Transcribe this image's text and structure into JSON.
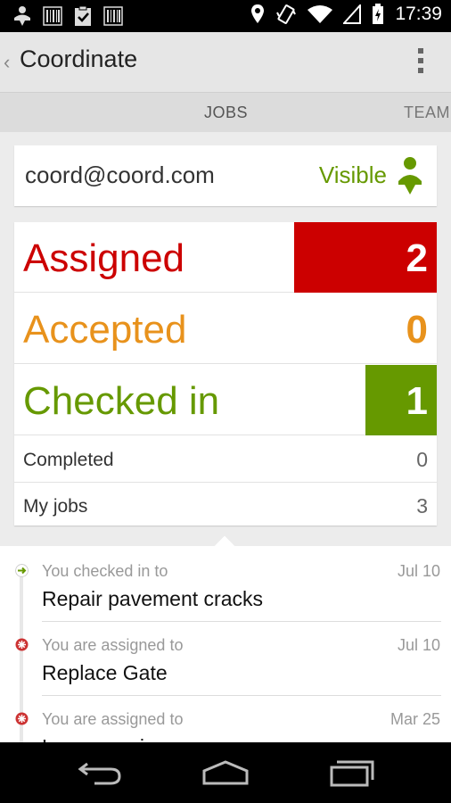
{
  "status_bar": {
    "time": "17:39",
    "left_icons": [
      "notification-person-icon",
      "barcode-icon",
      "clipboard-check-icon",
      "barcode-icon"
    ],
    "right_icons": [
      "location-icon",
      "vibrate-icon",
      "wifi-icon",
      "signal-icon",
      "battery-charging-icon"
    ]
  },
  "action_bar": {
    "title": "Coordinate",
    "back_glyph": "‹",
    "overflow_icon": "overflow-menu-icon"
  },
  "tabs": [
    {
      "label": "JOBS",
      "active": true
    },
    {
      "label": "TEAM",
      "active": false
    }
  ],
  "user": {
    "email": "coord@coord.com",
    "status": "Visible",
    "status_color": "#669900"
  },
  "stats": {
    "assigned": {
      "label": "Assigned",
      "count": "2",
      "color": "#cc0000"
    },
    "accepted": {
      "label": "Accepted",
      "count": "0",
      "color": "#e8921c"
    },
    "checked_in": {
      "label": "Checked in",
      "count": "1",
      "color": "#669900"
    },
    "completed": {
      "label": "Completed",
      "count": "0"
    },
    "my_jobs": {
      "label": "My jobs",
      "count": "3"
    }
  },
  "feed": [
    {
      "caption": "You checked in to",
      "date": "Jul 10",
      "title": "Repair pavement cracks",
      "icon": "checked-in-icon",
      "color": "#669900"
    },
    {
      "caption": "You are assigned to",
      "date": "Jul 10",
      "title": "Replace Gate",
      "icon": "assigned-icon",
      "color": "#cc3333"
    },
    {
      "caption": "You are assigned to",
      "date": "Mar 25",
      "title": "Lawn mowing",
      "icon": "assigned-icon",
      "color": "#cc3333"
    }
  ],
  "nav": [
    "back-icon",
    "home-icon",
    "recent-apps-icon"
  ]
}
